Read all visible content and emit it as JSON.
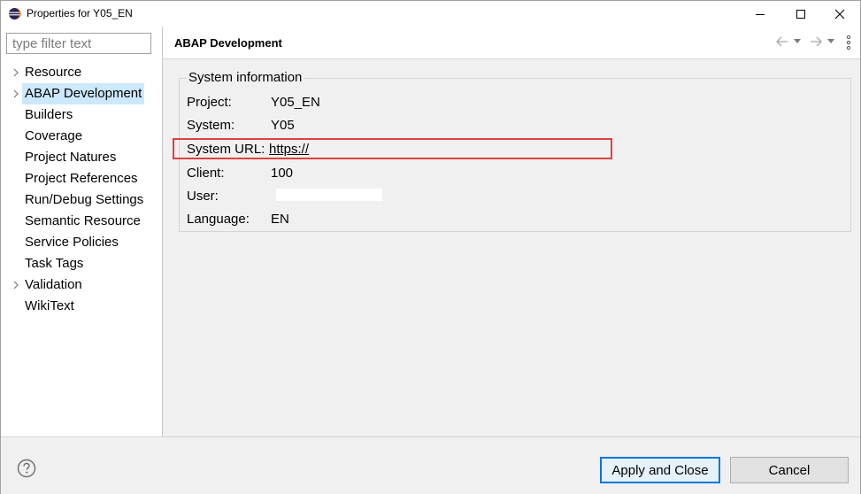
{
  "window": {
    "title": "Properties for Y05_EN"
  },
  "filter": {
    "placeholder": "type filter text"
  },
  "tree": {
    "items": [
      {
        "label": "Resource",
        "expandable": true
      },
      {
        "label": "ABAP Development",
        "expandable": true,
        "selected": true
      },
      {
        "label": "Builders",
        "expandable": false
      },
      {
        "label": "Coverage",
        "expandable": false
      },
      {
        "label": "Project Natures",
        "expandable": false
      },
      {
        "label": "Project References",
        "expandable": false
      },
      {
        "label": "Run/Debug Settings",
        "expandable": false
      },
      {
        "label": "Semantic Resource",
        "expandable": false
      },
      {
        "label": "Service Policies",
        "expandable": false
      },
      {
        "label": "Task Tags",
        "expandable": false
      },
      {
        "label": "Validation",
        "expandable": true
      },
      {
        "label": "WikiText",
        "expandable": false
      }
    ]
  },
  "page": {
    "title": "ABAP Development",
    "group_title": "System information",
    "fields": {
      "project": {
        "label": "Project:",
        "value": "Y05_EN"
      },
      "system": {
        "label": "System:",
        "value": "Y05"
      },
      "system_url": {
        "label": "System URL:",
        "value": "https://"
      },
      "client": {
        "label": "Client:",
        "value": "100"
      },
      "user": {
        "label": "User:",
        "value": ""
      },
      "language": {
        "label": "Language:",
        "value": "EN"
      }
    }
  },
  "buttons": {
    "apply_close": "Apply and Close",
    "cancel": "Cancel"
  },
  "colors": {
    "selection": "#cce8ff",
    "highlight_border": "#e04040",
    "primary_button_border": "#0078d7"
  }
}
